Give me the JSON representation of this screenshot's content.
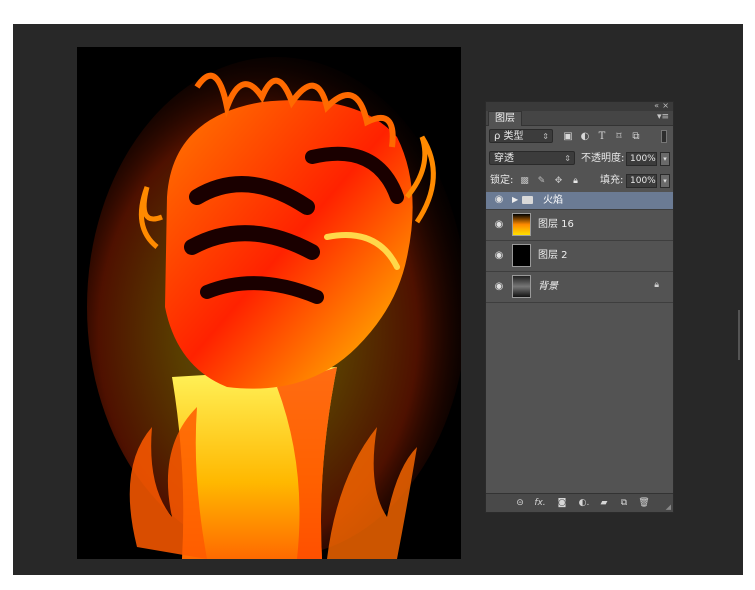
{
  "panel": {
    "title_controls": {
      "collapse": "«",
      "close": "×"
    },
    "tab": "图层",
    "filter": {
      "selected": "ρ 类型"
    },
    "blend": {
      "mode": "穿透",
      "opacity_label": "不透明度:",
      "opacity_value": "100%"
    },
    "lock": {
      "label": "锁定:",
      "fill_label": "填充:",
      "fill_value": "100%"
    },
    "layers": [
      {
        "name": "火焰",
        "type": "group"
      },
      {
        "name": "图层 16",
        "type": "image"
      },
      {
        "name": "图层 2",
        "type": "solid"
      },
      {
        "name": "背景",
        "type": "background"
      }
    ]
  },
  "colors": {
    "workspace": "#282828",
    "panel": "#535353",
    "selected_layer": "#6b7b94"
  }
}
